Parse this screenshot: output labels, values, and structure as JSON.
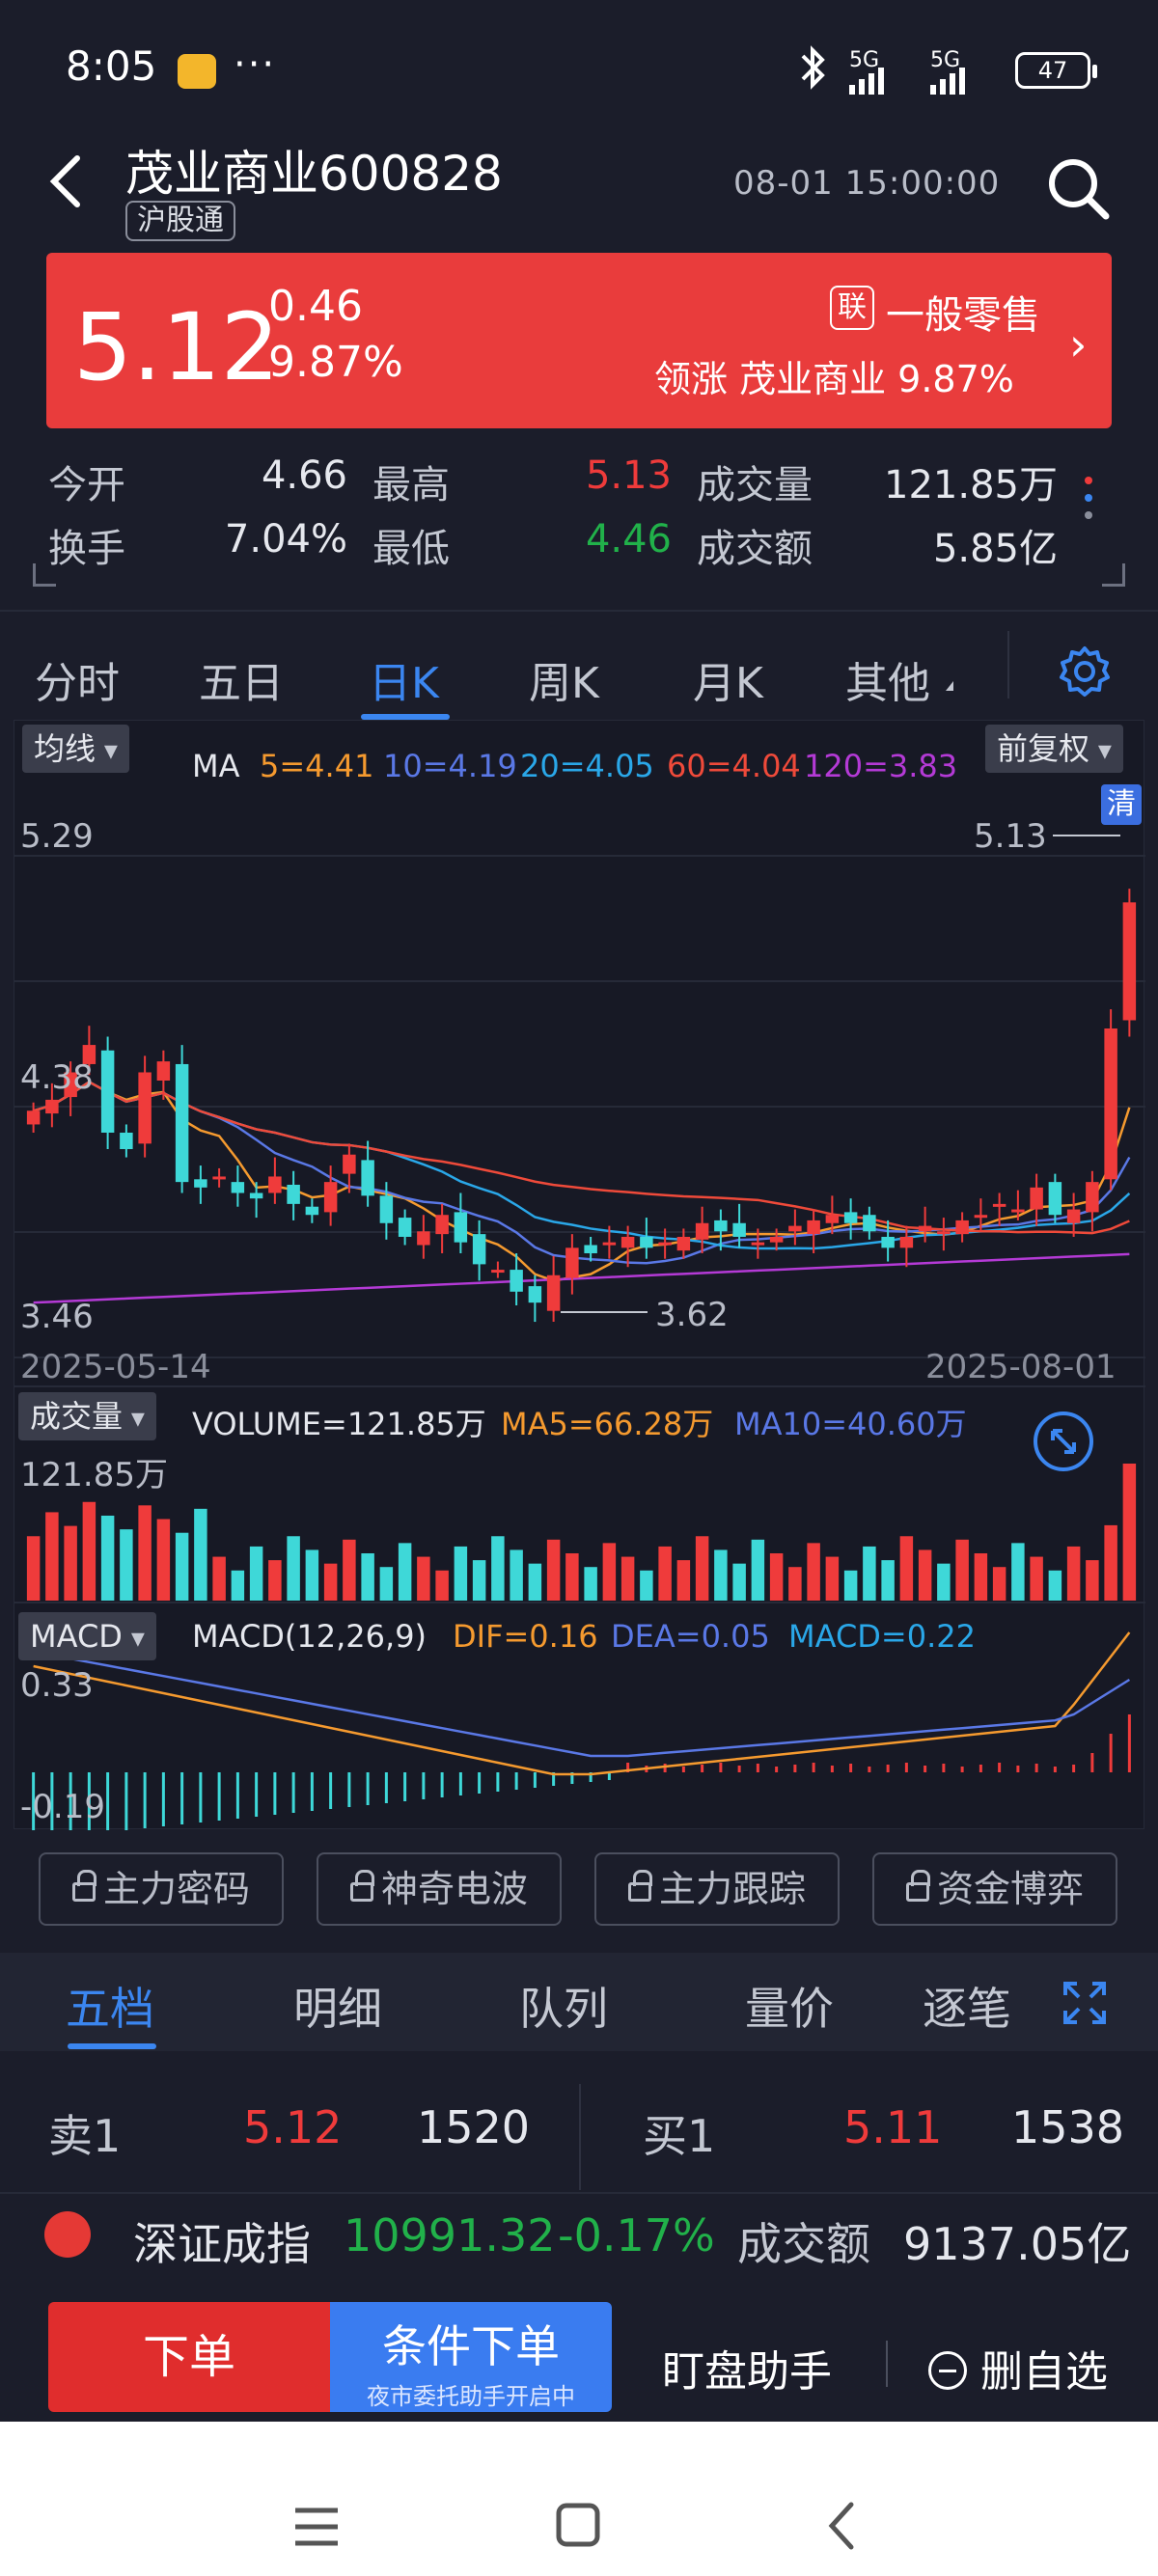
{
  "status_bar": {
    "time": "8:05",
    "dots": "···",
    "signal1": "5G",
    "signal2": "5G",
    "battery": "47"
  },
  "header": {
    "stock_name": "茂业商业600828",
    "tag": "沪股通",
    "datetime": "08-01 15:00:00"
  },
  "quote": {
    "price": "5.12",
    "change": "0.46",
    "change_pct": "9.87%",
    "sector_badge": "联",
    "sector": "一般零售",
    "leader_text": "领涨  茂业商业  9.87%"
  },
  "stats": [
    {
      "label": "今开",
      "value": "4.66",
      "color": "normal"
    },
    {
      "label": "最高",
      "value": "5.13",
      "color": "red"
    },
    {
      "label": "成交量",
      "value": "121.85万",
      "color": "normal"
    },
    {
      "label": "换手",
      "value": "7.04%",
      "color": "normal"
    },
    {
      "label": "最低",
      "value": "4.46",
      "color": "green"
    },
    {
      "label": "成交额",
      "value": "5.85亿",
      "color": "normal"
    }
  ],
  "tabs": [
    "分时",
    "五日",
    "日K",
    "周K",
    "月K",
    "其他"
  ],
  "active_tab": "日K",
  "chart": {
    "ma_dropdown": "均线",
    "ma_prefix": "MA",
    "ma5": "5=4.41",
    "ma10": "10=4.19",
    "ma20": "20=4.05",
    "ma60": "60=4.04",
    "ma120": "120=3.83",
    "adjust_dropdown": "前复权",
    "y_top": "5.29",
    "y_mid": "4.38",
    "y_bottom": "3.46",
    "max_label": "5.13",
    "min_label": "3.62",
    "qing_tag": "清",
    "date_start": "2025-05-14",
    "date_end": "2025-08-01",
    "vol_dropdown": "成交量",
    "vol_main": "VOLUME=121.85万",
    "vol_ma5": "MA5=66.28万",
    "vol_ma10": "MA10=40.60万",
    "vol_max": "121.85万",
    "macd_dropdown": "MACD",
    "macd_params": "MACD(12,26,9)",
    "macd_dif": "DIF=0.16",
    "macd_dea": "DEA=0.05",
    "macd_val": "MACD=0.22",
    "macd_top": "0.33",
    "macd_bottom": "-0.19",
    "colors": {
      "ma5": "#f59a2f",
      "ma10": "#5a78e6",
      "ma20": "#2aa7e8",
      "ma60": "#ef4a3a",
      "ma120": "#b43ad6",
      "up": "#ef3b3b",
      "down": "#3ed8d8"
    }
  },
  "chart_data": {
    "type": "candlestick",
    "x_range": [
      "2025-05-14",
      "2025-08-01"
    ],
    "ylim": [
      3.46,
      5.29
    ],
    "closes": [
      4.36,
      4.4,
      4.5,
      4.6,
      4.28,
      4.22,
      4.5,
      4.54,
      4.1,
      4.08,
      4.12,
      4.06,
      4.04,
      4.12,
      4.02,
      3.98,
      4.1,
      4.2,
      4.05,
      3.95,
      3.9,
      3.92,
      3.98,
      3.88,
      3.8,
      3.78,
      3.7,
      3.66,
      3.76,
      3.86,
      3.84,
      3.88,
      3.9,
      3.86,
      3.88,
      3.9,
      3.95,
      3.92,
      3.9,
      3.88,
      3.9,
      3.94,
      3.96,
      3.98,
      3.95,
      3.92,
      3.86,
      3.9,
      3.94,
      3.92,
      3.96,
      3.98,
      4.02,
      4.0,
      4.08,
      3.98,
      4.0,
      4.1,
      4.66,
      5.12
    ],
    "volume_max": "121.85万",
    "macd_range": [
      -0.19,
      0.33
    ]
  },
  "feature_buttons": [
    "主力密码",
    "神奇电波",
    "主力跟踪",
    "资金博弈"
  ],
  "lower_tabs": [
    "五档",
    "明细",
    "队列",
    "量价",
    "逐笔"
  ],
  "active_lower_tab": "五档",
  "order_book": {
    "sell_label": "卖1",
    "sell_price": "5.12",
    "sell_vol": "1520",
    "buy_label": "买1",
    "buy_price": "5.11",
    "buy_vol": "1538"
  },
  "index_ticker": {
    "name": "深证成指",
    "value": "10991.32",
    "pct": "-0.17%",
    "amount_label": "成交额",
    "amount": "9137.05亿"
  },
  "actions": {
    "order": "下单",
    "conditional": "条件下单",
    "conditional_sub": "夜市委托助手开启中",
    "helper": "盯盘助手",
    "remove_fav": "删自选"
  }
}
